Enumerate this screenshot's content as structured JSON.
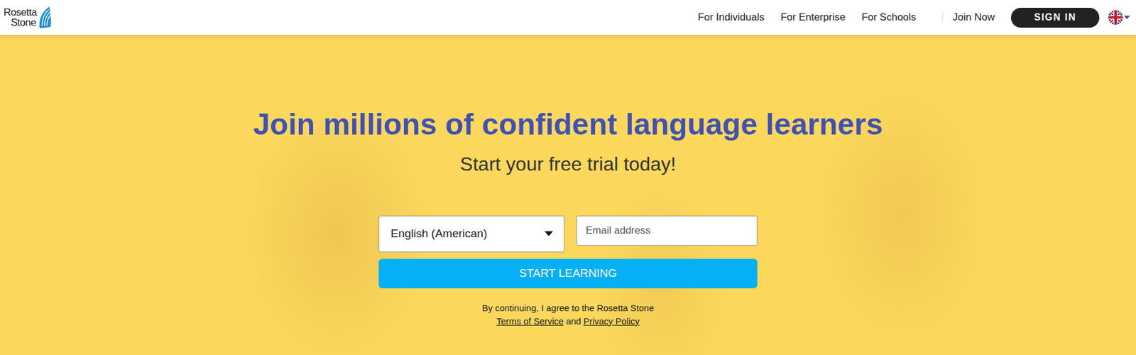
{
  "header": {
    "logo": {
      "lines": [
        "Rosetta",
        "Stone"
      ]
    },
    "nav": [
      "For Individuals",
      "For Enterprise",
      "For Schools"
    ],
    "join": "Join Now",
    "sign_in": "SIGN IN"
  },
  "hero": {
    "title": "Join millions of confident language learners",
    "subtitle": "Start your free trial today!"
  },
  "form": {
    "language": "English (American)",
    "email_placeholder": "Email address",
    "button": "START LEARNING"
  },
  "legal": {
    "text": "By continuing, I agree to the Rosetta Stone",
    "terms": "Terms of Service",
    "and": "and",
    "privacy": "Privacy Policy"
  }
}
